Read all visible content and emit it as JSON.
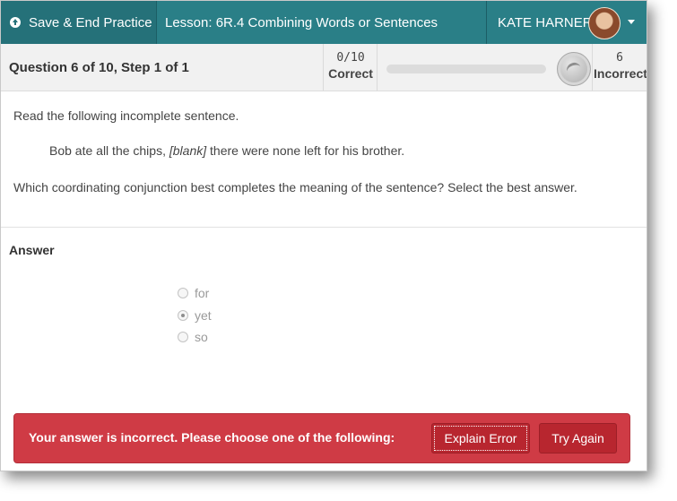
{
  "header": {
    "save_label": "Save & End Practice",
    "lesson_title": "Lesson: 6R.4 Combining Words or Sentences",
    "user_name": "KATE HARNER"
  },
  "status": {
    "question_label": "Question 6 of 10,  Step 1 of 1",
    "correct_count": "0/10",
    "correct_label": "Correct",
    "progress_fraction": 0,
    "incorrect_count": "6",
    "incorrect_label": "Incorrect"
  },
  "question": {
    "intro": "Read the following incomplete sentence.",
    "sentence_before": "Bob ate all the chips, ",
    "sentence_blank": "[blank]",
    "sentence_after": " there were none left for his brother.",
    "prompt": "Which coordinating conjunction best completes the meaning of the sentence? Select the best answer."
  },
  "answer": {
    "heading": "Answer",
    "options": [
      {
        "label": "for",
        "selected": false
      },
      {
        "label": "yet",
        "selected": true
      },
      {
        "label": "so",
        "selected": false
      }
    ]
  },
  "feedback": {
    "message": "Your answer is incorrect. Please choose one of the following:",
    "explain_label": "Explain Error",
    "retry_label": "Try Again"
  },
  "colors": {
    "header_bg": "#2a7f87",
    "alert_bg": "#cf3b45",
    "alert_button_bg": "#b8262f"
  },
  "icons": {
    "save": "circle-arrow-up-icon",
    "user_menu": "chevron-down-icon",
    "badge": "medal-icon"
  }
}
